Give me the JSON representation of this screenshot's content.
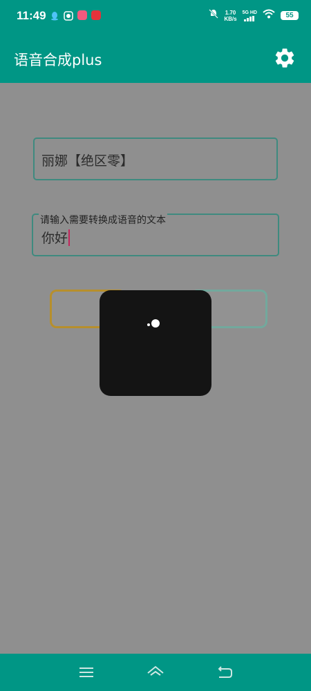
{
  "status_bar": {
    "time": "11:49",
    "net_speed_value": "1.70",
    "net_speed_unit": "KB/s",
    "network_label": "5G HD",
    "battery": "55"
  },
  "app_bar": {
    "title": "语音合成plus",
    "settings_icon": "gear-icon"
  },
  "main": {
    "voice_selector_value": "丽娜【绝区零】",
    "text_input_label": "请输入需要转换成语音的文本",
    "text_input_value": "你好"
  },
  "colors": {
    "primary": "#009685",
    "overlay": "#8f8f8f",
    "dialog": "#141414",
    "caret": "#c3245b"
  },
  "nav_bar": {
    "items": [
      "menu-icon",
      "home-icon",
      "back-icon"
    ]
  }
}
